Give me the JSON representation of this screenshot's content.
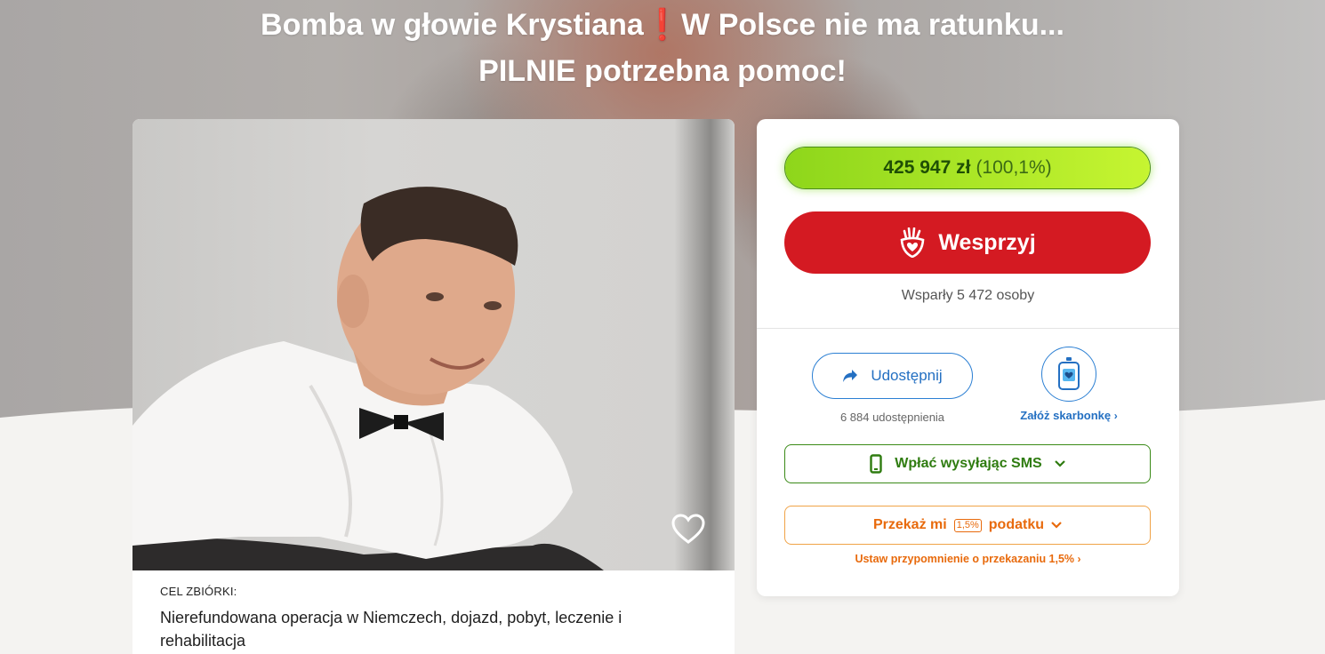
{
  "header": {
    "title_part1": "Bomba w głowie Krystiana",
    "title_emoji": "❗",
    "title_part2": "W Polsce nie ma ratunku... PILNIE potrzebna pomoc!"
  },
  "campaign": {
    "goal_label": "CEL ZBIÓRKI:",
    "goal_text": "Nierefundowana operacja w Niemczech, dojazd, pobyt, leczenie i rehabilitacja",
    "favorite_icon": "heart-outline-icon"
  },
  "donation": {
    "amount": "425 947 zł",
    "percent": "(100,1%)",
    "progress_fraction": 1.0,
    "support_label": "Wesprzyj",
    "supporters_text": "Wsparły 5 472 osoby",
    "share_label": "Udostępnij",
    "share_count": "6 884 udostępnienia",
    "piggy_label": "Załóż skarbonkę",
    "sms_label": "Wpłać wysyłając SMS",
    "tax_label_before": "Przekaż mi",
    "tax_badge": "1,5%",
    "tax_label_after": "podatku",
    "reminder_label": "Ustaw przypomnienie o przekazaniu 1,5%",
    "colors": {
      "support": "#d41a22",
      "progress": "#a6e526",
      "share": "#2470c2",
      "sms": "#2f7c10",
      "tax": "#e86a0c"
    }
  }
}
